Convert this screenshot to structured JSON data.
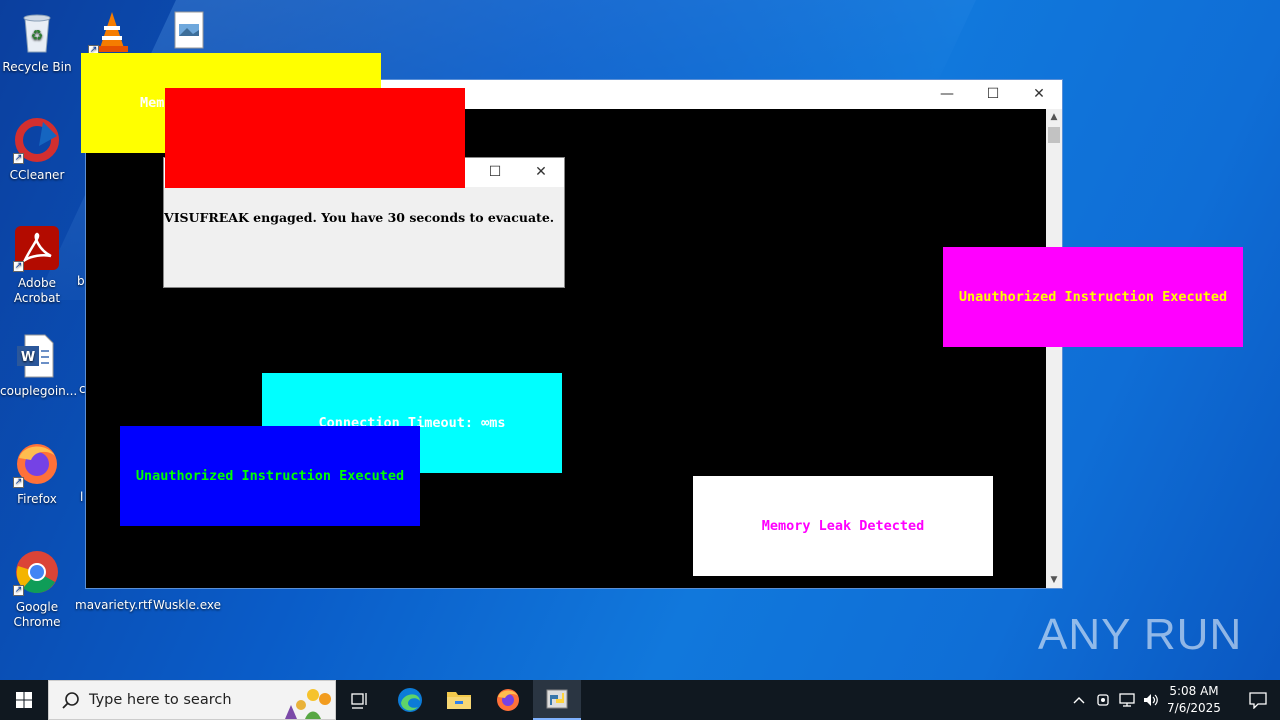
{
  "desktop": {
    "icons": [
      {
        "name": "recycle-bin",
        "label": "Recycle Bin"
      },
      {
        "name": "ccleaner",
        "label": "CCleaner"
      },
      {
        "name": "adobe-acrobat",
        "label": "Adobe Acrobat"
      },
      {
        "name": "word-doc",
        "label": "couplegoin..."
      },
      {
        "name": "firefox",
        "label": "Firefox"
      },
      {
        "name": "google-chrome",
        "label": "Google Chrome"
      },
      {
        "name": "mavariety",
        "label": "mavariety.rtf"
      },
      {
        "name": "wuskle",
        "label": "Wuskle.exe"
      }
    ],
    "partial_labels": [
      "b",
      "c",
      "l"
    ]
  },
  "main_window": {
    "console_bg": "#000000",
    "buttons": {
      "minimize": "—",
      "maximize": "☐",
      "close": "✕"
    }
  },
  "popups": {
    "yellow": {
      "text": "Mem",
      "bg": "#ffff00",
      "fg": "#ffffff"
    },
    "red": {
      "text": "",
      "bg": "#ff0000"
    },
    "magenta": {
      "text": "Unauthorized Instruction Executed",
      "bg": "#ff00ff",
      "fg": "#ffff00"
    },
    "cyan": {
      "text": "Connection Timeout: ∞ms",
      "bg": "#00ffff",
      "fg": "#ffffff"
    },
    "blue": {
      "text": "Unauthorized Instruction Executed",
      "bg": "#0000ff",
      "fg": "#00ff00"
    },
    "white": {
      "text": "Memory Leak Detected",
      "bg": "#ffffff",
      "fg": "#ff00ff"
    }
  },
  "message_box": {
    "text": "VISUFREAK engaged. You have 30 seconds to evacuate.",
    "buttons": {
      "maximize": "☐",
      "close": "✕"
    }
  },
  "taskbar": {
    "search_placeholder": "Type here to search",
    "time": "5:08 AM",
    "date": "7/6/2025"
  },
  "watermark": "ANY RUN"
}
